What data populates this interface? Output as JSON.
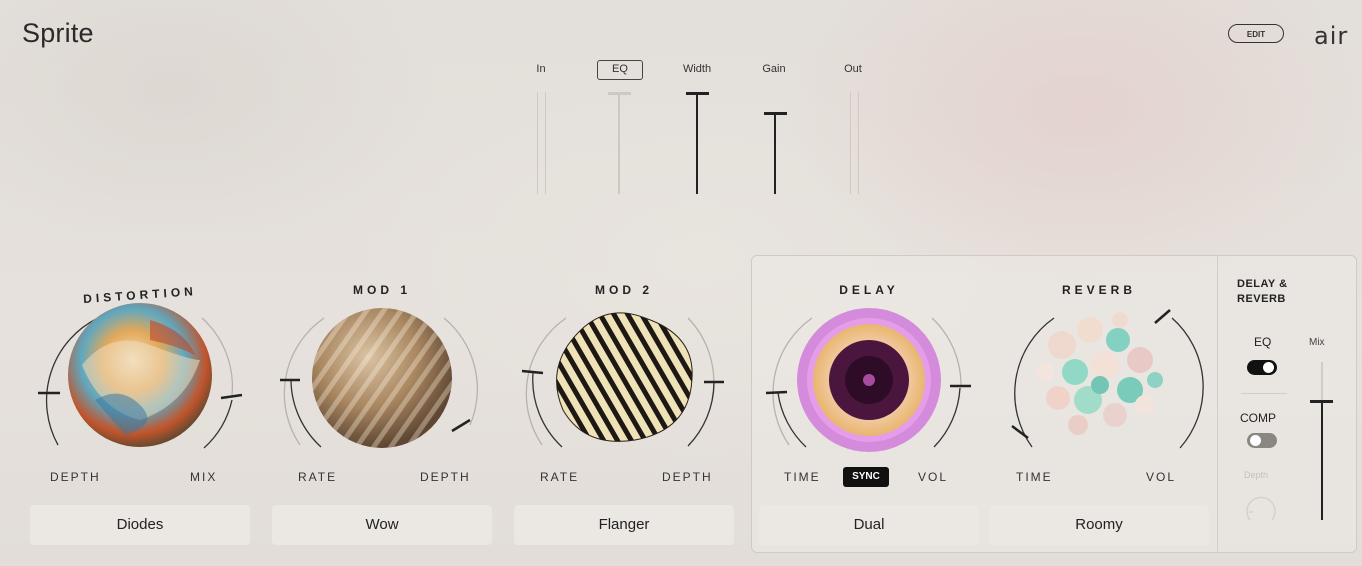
{
  "app": {
    "title": "Sprite",
    "edit_label": "EDIT",
    "logo": "air"
  },
  "faders": {
    "in_label": "In",
    "eq_label": "EQ",
    "width_label": "Width",
    "gain_label": "Gain",
    "out_label": "Out",
    "width_level": 1.0,
    "gain_level": 0.8
  },
  "modules": {
    "distortion": {
      "title": "DISTORTION",
      "left_label": "DEPTH",
      "right_label": "MIX",
      "preset": "Diodes"
    },
    "mod1": {
      "title": "MOD 1",
      "left_label": "RATE",
      "right_label": "DEPTH",
      "preset": "Wow"
    },
    "mod2": {
      "title": "MOD 2",
      "left_label": "RATE",
      "right_label": "DEPTH",
      "preset": "Flanger"
    },
    "delay": {
      "title": "DELAY",
      "left_label": "TIME",
      "sync_label": "SYNC",
      "right_label": "VOL",
      "preset": "Dual"
    },
    "reverb": {
      "title": "REVERB",
      "left_label": "TIME",
      "right_label": "VOL",
      "preset": "Roomy"
    }
  },
  "side": {
    "title_line1": "DELAY &",
    "title_line2": "REVERB",
    "eq_label": "EQ",
    "eq_on": true,
    "comp_label": "COMP",
    "comp_on": false,
    "depth_label": "Depth",
    "mix_label": "Mix",
    "mix_level": 0.75
  },
  "colors": {
    "delay_ring": "#d58bdc",
    "accent_dark": "#222222"
  }
}
